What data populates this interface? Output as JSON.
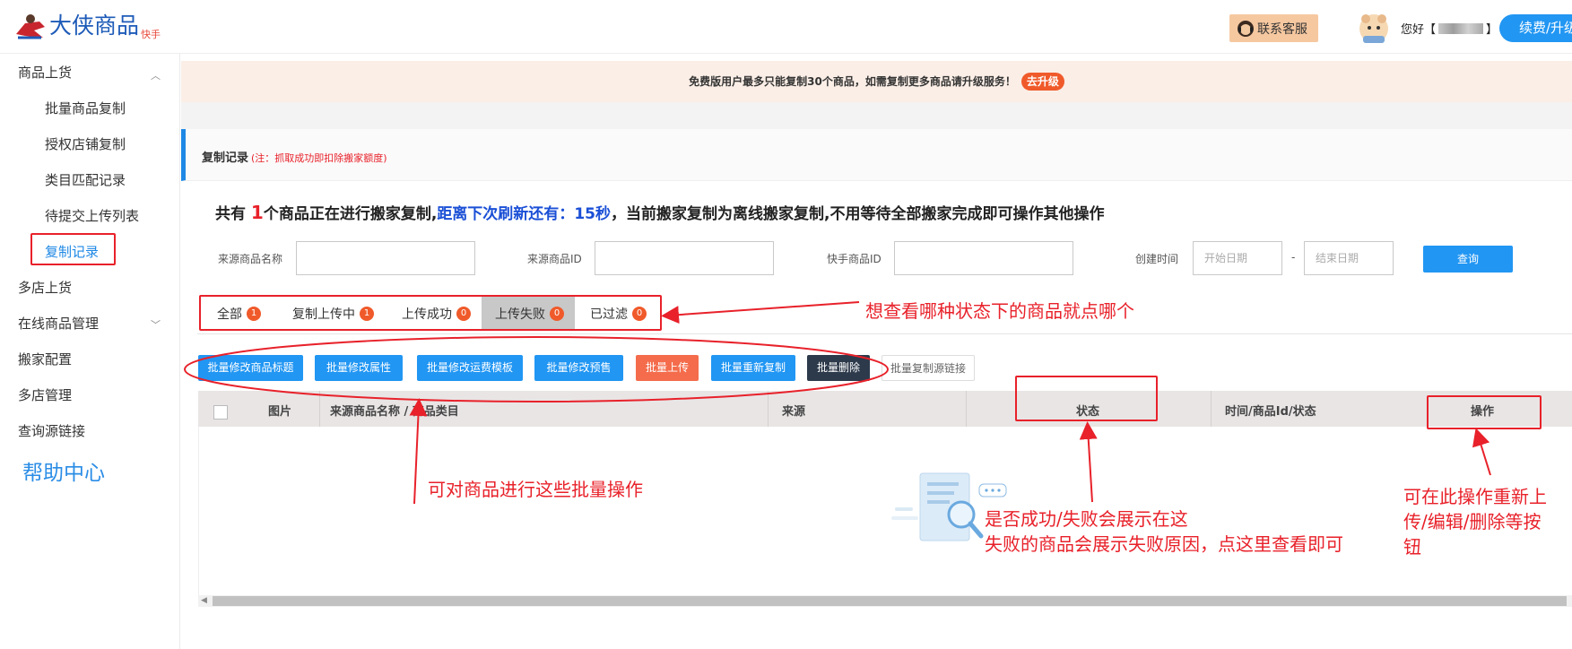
{
  "header": {
    "logo_text": "大侠商品",
    "logo_sub": "快手",
    "support_label": "联系客服",
    "greeting_prefix": "您好【",
    "greeting_suffix": "】",
    "renew_label": "续费/升级"
  },
  "sidebar": {
    "groups": [
      {
        "label": "商品上货",
        "items": [
          "批量商品复制",
          "授权店铺复制",
          "类目匹配记录",
          "待提交上传列表",
          "复制记录"
        ]
      },
      {
        "label": "多店上货"
      },
      {
        "label": "在线商品管理"
      },
      {
        "label": "搬家配置"
      },
      {
        "label": "多店管理"
      },
      {
        "label": "查询源链接"
      }
    ],
    "help_label": "帮助中心"
  },
  "notice": {
    "text": "免费版用户最多只能复制30个商品，如需复制更多商品请升级服务！",
    "button": "去升级"
  },
  "section": {
    "title": "复制记录",
    "note": "(注：抓取成功即扣除搬家额度)"
  },
  "summary": {
    "prefix": "共有",
    "count": "1",
    "part1": "个商品正在进行搬家复制,",
    "countdown_label": "距离下次刷新还有：",
    "countdown": "15秒",
    "part2": "，当前搬家复制为离线搬家复制,不用等待全部搬家完成即可操作其他操作"
  },
  "filters": {
    "source_name_label": "来源商品名称",
    "source_id_label": "来源商品ID",
    "ks_id_label": "快手商品ID",
    "created_label": "创建时间",
    "start_placeholder": "开始日期",
    "dash": "-",
    "end_placeholder": "结束日期",
    "query_label": "查询"
  },
  "tabs": [
    {
      "label": "全部",
      "count": "1"
    },
    {
      "label": "复制上传中",
      "count": "1"
    },
    {
      "label": "上传成功",
      "count": "0"
    },
    {
      "label": "上传失败",
      "count": "0",
      "active": true
    },
    {
      "label": "已过滤",
      "count": "0"
    }
  ],
  "batch_buttons": [
    "批量修改商品标题",
    "批量修改属性",
    "批量修改运费模板",
    "批量修改预售",
    "批量上传",
    "批量重新复制",
    "批量删除",
    "批量复制源链接"
  ],
  "table": {
    "columns": [
      "图片",
      "来源商品名称 / 商品类目",
      "来源",
      "状态",
      "时间/商品Id/状态",
      "操作"
    ]
  },
  "annotations": {
    "tabs_hint": "想查看哪种状态下的商品就点哪个",
    "batch_hint": "可对商品进行这些批量操作",
    "status_hint_1": "是否成功/失败会展示在这",
    "status_hint_2": "失败的商品会展示失败原因，点这里查看即可",
    "ops_hint_1": "可在此操作重新上",
    "ops_hint_2": "传/编辑/删除等按",
    "ops_hint_3": "钮"
  },
  "colors": {
    "accent": "#2196f3",
    "annotation_red": "#e8212a",
    "badge": "#f05a2a"
  }
}
